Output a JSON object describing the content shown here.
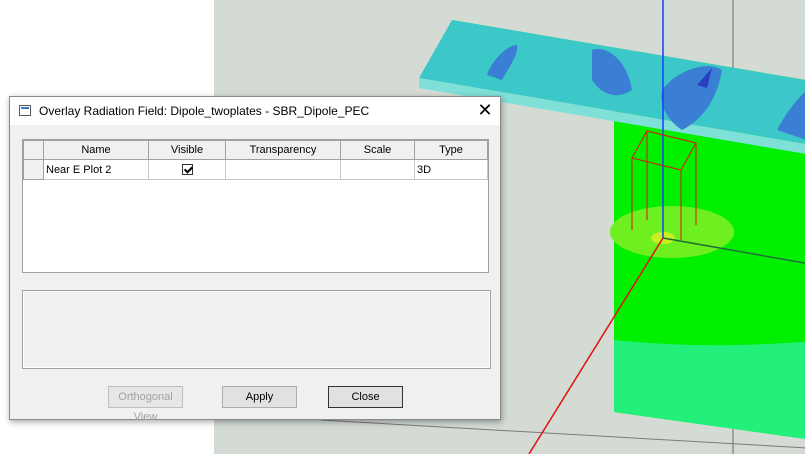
{
  "dialog": {
    "title": "Overlay Radiation Field: Dipole_twoplates - SBR_Dipole_PEC",
    "close_glyph": "✕"
  },
  "grid": {
    "columns": [
      "Name",
      "Visible",
      "Transparency",
      "Scale",
      "Type"
    ],
    "rows": [
      {
        "name": "Near E Plot 2",
        "visible": true,
        "transparency": "",
        "scale": "",
        "type": "3D"
      }
    ]
  },
  "buttons": {
    "orthogonal_view": "Orthogonal View",
    "apply": "Apply",
    "close": "Close"
  },
  "colors": {
    "plane_green": "#00f000",
    "field_cyan": "#33cccc",
    "field_blue": "#3b7fd4",
    "axis_blue": "#1a3cff",
    "axis_red": "#e01010",
    "background": "#d4dbd4"
  }
}
